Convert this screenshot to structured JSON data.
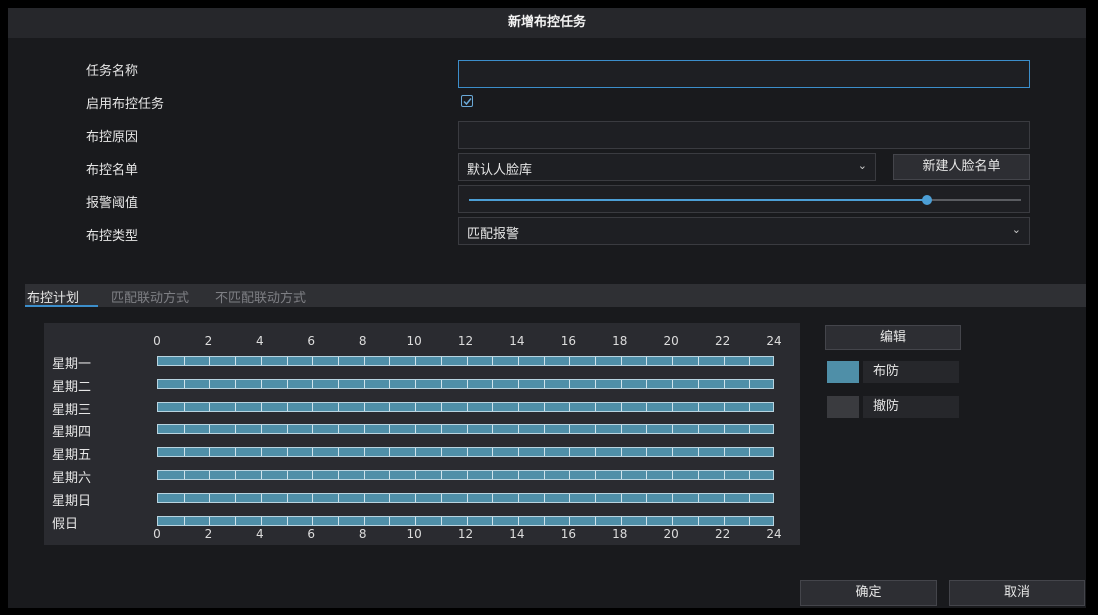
{
  "dialog": {
    "title": "新增布控任务"
  },
  "form": {
    "task_name_label": "任务名称",
    "task_name_value": "",
    "enable_label": "启用布控任务",
    "enable_checked": true,
    "reason_label": "布控原因",
    "reason_value": "",
    "list_label": "布控名单",
    "list_value": "默认人脸库",
    "new_list_button": "新建人脸名单",
    "threshold_label": "报警阈值",
    "threshold_value": 0.83,
    "type_label": "布控类型",
    "type_value": "匹配报警"
  },
  "tabs": [
    {
      "label": "布控计划",
      "active": true
    },
    {
      "label": "匹配联动方式",
      "active": false
    },
    {
      "label": "不匹配联动方式",
      "active": false
    }
  ],
  "schedule": {
    "hours": [
      "0",
      "2",
      "4",
      "6",
      "8",
      "10",
      "12",
      "14",
      "16",
      "18",
      "20",
      "22",
      "24"
    ],
    "days": [
      "星期一",
      "星期二",
      "星期三",
      "星期四",
      "星期五",
      "星期六",
      "星期日",
      "假日"
    ],
    "edit_button": "编辑",
    "legend": [
      {
        "label": "布防",
        "color": "#4f8fa8"
      },
      {
        "label": "撤防",
        "color": "#3a3b3f"
      }
    ]
  },
  "footer": {
    "ok_button": "确定",
    "cancel_button": "取消"
  }
}
